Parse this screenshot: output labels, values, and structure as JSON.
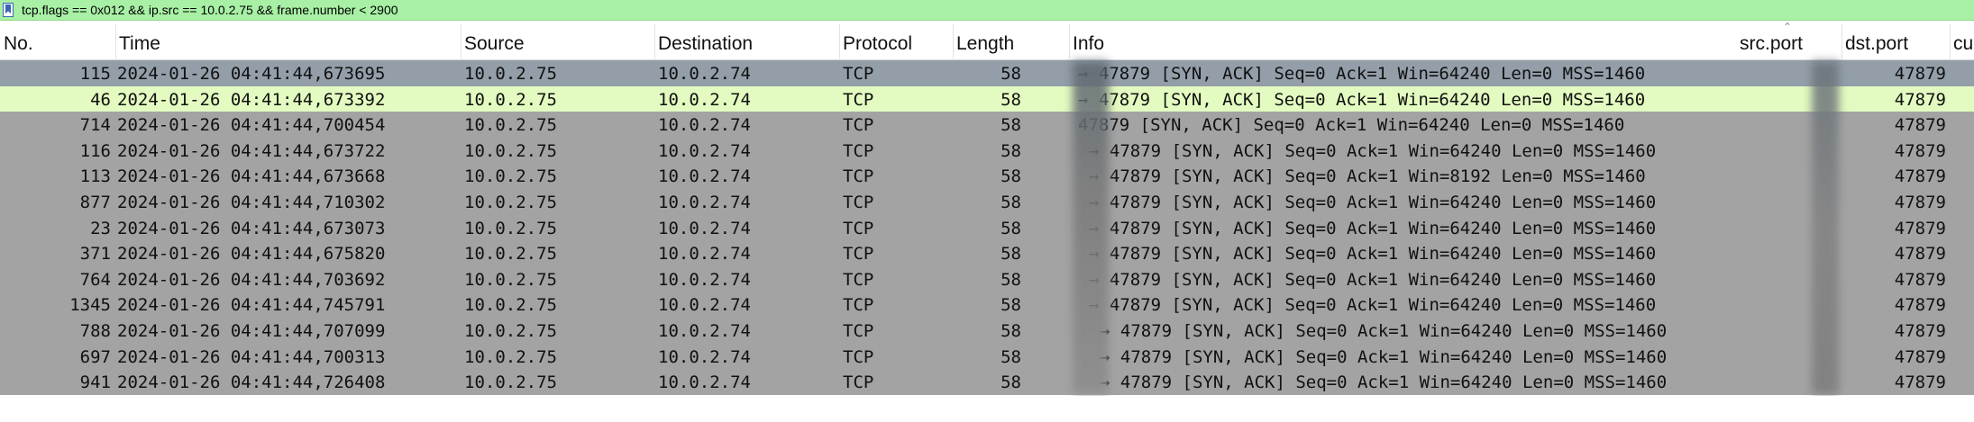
{
  "filter": {
    "text": "tcp.flags == 0x012 && ip.src == 10.0.2.75 && frame.number < 2900",
    "icon": "bookmark-icon"
  },
  "columns": [
    {
      "key": "no",
      "label": "No."
    },
    {
      "key": "time",
      "label": "Time"
    },
    {
      "key": "source",
      "label": "Source"
    },
    {
      "key": "destination",
      "label": "Destination"
    },
    {
      "key": "protocol",
      "label": "Protocol"
    },
    {
      "key": "length",
      "label": "Length"
    },
    {
      "key": "info",
      "label": "Info"
    },
    {
      "key": "src_port",
      "label": "src.port"
    },
    {
      "key": "dst_port",
      "label": "dst.port"
    },
    {
      "key": "cu",
      "label": "cu"
    }
  ],
  "sorted_column": "src.port",
  "rows": [
    {
      "no": "115",
      "time": "2024-01-26 04:41:44,673695",
      "source": "10.0.2.75",
      "destination": "10.0.2.74",
      "protocol": "TCP",
      "length": "58",
      "info": "→ 47879 [SYN, ACK] Seq=0 Ack=1 Win=64240 Len=0 MSS=1460",
      "dst_port": "47879"
    },
    {
      "no": "46",
      "time": "2024-01-26 04:41:44,673392",
      "source": "10.0.2.75",
      "destination": "10.0.2.74",
      "protocol": "TCP",
      "length": "58",
      "info": "→ 47879 [SYN, ACK] Seq=0 Ack=1 Win=64240 Len=0 MSS=1460",
      "dst_port": "47879"
    },
    {
      "no": "714",
      "time": "2024-01-26 04:41:44,700454",
      "source": "10.0.2.75",
      "destination": "10.0.2.74",
      "protocol": "TCP",
      "length": "58",
      "info": "47879 [SYN, ACK] Seq=0 Ack=1 Win=64240 Len=0 MSS=1460",
      "dst_port": "47879"
    },
    {
      "no": "116",
      "time": "2024-01-26 04:41:44,673722",
      "source": "10.0.2.75",
      "destination": "10.0.2.74",
      "protocol": "TCP",
      "length": "58",
      "info": "→ 47879 [SYN, ACK] Seq=0 Ack=1 Win=64240 Len=0 MSS=1460",
      "dst_port": "47879"
    },
    {
      "no": "113",
      "time": "2024-01-26 04:41:44,673668",
      "source": "10.0.2.75",
      "destination": "10.0.2.74",
      "protocol": "TCP",
      "length": "58",
      "info": "→ 47879 [SYN, ACK] Seq=0 Ack=1 Win=8192 Len=0 MSS=1460",
      "dst_port": "47879"
    },
    {
      "no": "877",
      "time": "2024-01-26 04:41:44,710302",
      "source": "10.0.2.75",
      "destination": "10.0.2.74",
      "protocol": "TCP",
      "length": "58",
      "info": "→ 47879 [SYN, ACK] Seq=0 Ack=1 Win=64240 Len=0 MSS=1460",
      "dst_port": "47879"
    },
    {
      "no": "23",
      "time": "2024-01-26 04:41:44,673073",
      "source": "10.0.2.75",
      "destination": "10.0.2.74",
      "protocol": "TCP",
      "length": "58",
      "info": "→ 47879 [SYN, ACK] Seq=0 Ack=1 Win=64240 Len=0 MSS=1460",
      "dst_port": "47879"
    },
    {
      "no": "371",
      "time": "2024-01-26 04:41:44,675820",
      "source": "10.0.2.75",
      "destination": "10.0.2.74",
      "protocol": "TCP",
      "length": "58",
      "info": "→ 47879 [SYN, ACK] Seq=0 Ack=1 Win=64240 Len=0 MSS=1460",
      "dst_port": "47879"
    },
    {
      "no": "764",
      "time": "2024-01-26 04:41:44,703692",
      "source": "10.0.2.75",
      "destination": "10.0.2.74",
      "protocol": "TCP",
      "length": "58",
      "info": "→ 47879 [SYN, ACK] Seq=0 Ack=1 Win=64240 Len=0 MSS=1460",
      "dst_port": "47879"
    },
    {
      "no": "1345",
      "time": "2024-01-26 04:41:44,745791",
      "source": "10.0.2.75",
      "destination": "10.0.2.74",
      "protocol": "TCP",
      "length": "58",
      "info": "→ 47879 [SYN, ACK] Seq=0 Ack=1 Win=64240 Len=0 MSS=1460",
      "dst_port": "47879"
    },
    {
      "no": "788",
      "time": "2024-01-26 04:41:44,707099",
      "source": "10.0.2.75",
      "destination": "10.0.2.74",
      "protocol": "TCP",
      "length": "58",
      "info": "→ 47879 [SYN, ACK] Seq=0 Ack=1 Win=64240 Len=0 MSS=1460",
      "dst_port": "47879"
    },
    {
      "no": "697",
      "time": "2024-01-26 04:41:44,700313",
      "source": "10.0.2.75",
      "destination": "10.0.2.74",
      "protocol": "TCP",
      "length": "58",
      "info": "→ 47879 [SYN, ACK] Seq=0 Ack=1 Win=64240 Len=0 MSS=1460",
      "dst_port": "47879"
    },
    {
      "no": "941",
      "time": "2024-01-26 04:41:44,726408",
      "source": "10.0.2.75",
      "destination": "10.0.2.74",
      "protocol": "TCP",
      "length": "58",
      "info": "→ 47879 [SYN, ACK] Seq=0 Ack=1 Win=64240 Len=0 MSS=1460",
      "dst_port": "47879"
    }
  ]
}
